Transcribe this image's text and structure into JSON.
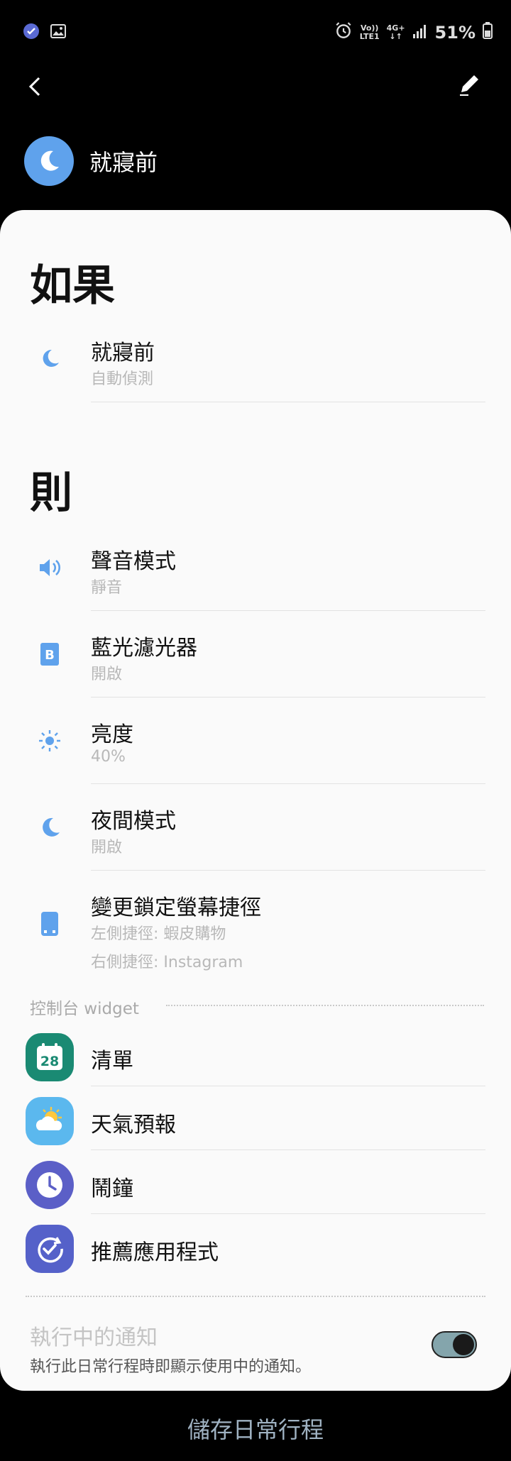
{
  "status_bar": {
    "network_top": "Vo))",
    "network_bottom": "LTE1",
    "data_top": "4G+",
    "data_bottom": "↓↑",
    "battery": "51%"
  },
  "routine": {
    "title": "就寢前"
  },
  "if_section": {
    "title": "如果",
    "items": [
      {
        "label": "就寢前",
        "sub": "自動偵測",
        "icon": "moon-icon"
      }
    ]
  },
  "then_section": {
    "title": "則",
    "items": [
      {
        "label": "聲音模式",
        "sub": "靜音",
        "icon": "speaker-icon"
      },
      {
        "label": "藍光濾光器",
        "sub": "開啟",
        "icon": "blue-light-filter-icon"
      },
      {
        "label": "亮度",
        "sub": "40%",
        "icon": "brightness-icon"
      },
      {
        "label": "夜間模式",
        "sub": "開啟",
        "icon": "night-mode-icon"
      },
      {
        "label": "變更鎖定螢幕捷徑",
        "sub": "左側捷徑: 蝦皮購物",
        "sub2": "右側捷徑: Instagram",
        "icon": "phone-icon"
      }
    ]
  },
  "widgets": {
    "header": "控制台 widget",
    "items": [
      {
        "label": "清單",
        "icon": "calendar-icon",
        "badge": "28",
        "color": "#1a8a73"
      },
      {
        "label": "天氣預報",
        "icon": "weather-icon",
        "color": "#5bb8ee"
      },
      {
        "label": "鬧鐘",
        "icon": "clock-icon",
        "color": "#5b5fc7"
      },
      {
        "label": "推薦應用程式",
        "icon": "suggested-apps-icon",
        "color": "#5561c9"
      }
    ]
  },
  "notification": {
    "title": "執行中的通知",
    "sub": "執行此日常行程時即顯示使用中的通知。",
    "enabled": true
  },
  "save_label": "儲存日常行程",
  "colors": {
    "accent": "#5fa2ec",
    "card": "#fafafa"
  }
}
